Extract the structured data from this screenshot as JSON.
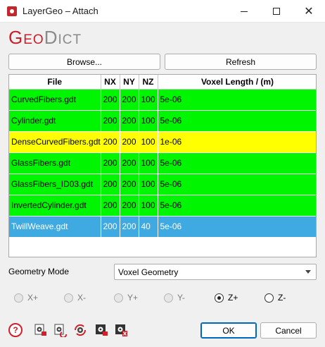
{
  "window": {
    "title": "LayerGeo – Attach"
  },
  "logo": {
    "part1_initial": "G",
    "part1_rest": "EO",
    "part2_initial": "D",
    "part2_rest": "ICT"
  },
  "toolbar": {
    "browse_label": "Browse...",
    "refresh_label": "Refresh"
  },
  "table": {
    "columns": [
      "File",
      "NX",
      "NY",
      "NZ",
      "Voxel Length / (m)"
    ],
    "rows": [
      {
        "file": "CurvedFibers.gdt",
        "nx": "200",
        "ny": "200",
        "nz": "100",
        "voxel": "5e-06",
        "color": "green"
      },
      {
        "file": "Cylinder.gdt",
        "nx": "200",
        "ny": "200",
        "nz": "100",
        "voxel": "5e-06",
        "color": "green"
      },
      {
        "file": "DenseCurvedFibers.gdt",
        "nx": "200",
        "ny": "200",
        "nz": "100",
        "voxel": "1e-06",
        "color": "yellow"
      },
      {
        "file": "GlassFibers.gdt",
        "nx": "200",
        "ny": "200",
        "nz": "100",
        "voxel": "5e-06",
        "color": "green"
      },
      {
        "file": "GlassFibers_ID03.gdt",
        "nx": "200",
        "ny": "200",
        "nz": "100",
        "voxel": "5e-06",
        "color": "green"
      },
      {
        "file": "InvertedCylinder.gdt",
        "nx": "200",
        "ny": "200",
        "nz": "100",
        "voxel": "5e-06",
        "color": "green"
      },
      {
        "file": "TwillWeave.gdt",
        "nx": "200",
        "ny": "200",
        "nz": "40",
        "voxel": "5e-06",
        "color": "selected"
      }
    ]
  },
  "geometry_mode": {
    "label": "Geometry Mode",
    "selected": "Voxel Geometry"
  },
  "directions": [
    {
      "label": "X+",
      "enabled": false,
      "checked": false
    },
    {
      "label": "X-",
      "enabled": false,
      "checked": false
    },
    {
      "label": "Y+",
      "enabled": false,
      "checked": false
    },
    {
      "label": "Y-",
      "enabled": false,
      "checked": false
    },
    {
      "label": "Z+",
      "enabled": true,
      "checked": true
    },
    {
      "label": "Z-",
      "enabled": true,
      "checked": false
    }
  ],
  "footer": {
    "help_text": "?",
    "ok_label": "OK",
    "cancel_label": "Cancel"
  },
  "colors": {
    "row_ok": "#00f500",
    "row_warn": "#ffff00",
    "row_selected": "#3fa9e1",
    "brand": "#c8202a"
  }
}
